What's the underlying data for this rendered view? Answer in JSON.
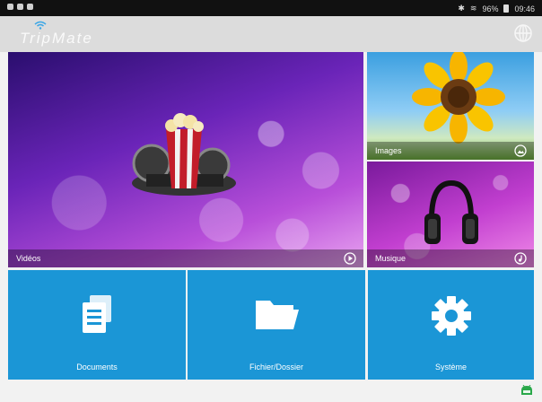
{
  "status_bar": {
    "right_text": "96%",
    "time": "09:46"
  },
  "app": {
    "title": "TripMate"
  },
  "tiles": {
    "videos": {
      "label": "Vidéos"
    },
    "images": {
      "label": "Images"
    },
    "music": {
      "label": "Musique"
    }
  },
  "buttons": {
    "documents": {
      "label": "Documents"
    },
    "fichier": {
      "label": "Fichier/Dossier"
    },
    "systeme": {
      "label": "Système"
    }
  },
  "colors": {
    "tile_blue": "#1b96d6",
    "android_green": "#2aa84a"
  }
}
